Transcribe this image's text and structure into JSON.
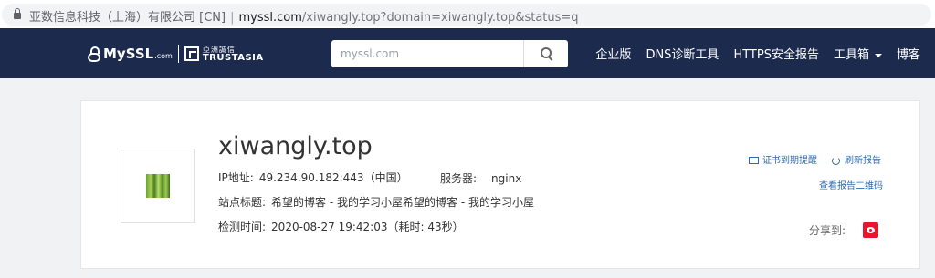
{
  "address_bar": {
    "org": "亚数信息科技（上海）有限公司 [CN]",
    "separator": "|",
    "domain": "myssl.com",
    "path": "/xiwangly.top?domain=xiwangly.top&status=q"
  },
  "nav": {
    "logo_text": "MySSL",
    "logo_suffix": ".com",
    "partner_cn": "亞洲誠信",
    "partner_en": "TRUSTASIA",
    "search_placeholder": "myssl.com",
    "links": [
      "企业版",
      "DNS诊断工具",
      "HTTPS安全报告",
      "工具箱",
      "博客"
    ]
  },
  "report": {
    "title": "xiwangly.top",
    "ip_label": "IP地址:",
    "ip_value": "49.234.90.182:443（中国）",
    "server_label": "服务器:",
    "server_value": "nginx",
    "site_title_label": "站点标题:",
    "site_title_value": "希望的博客 - 我的学习小屋希望的博客 - 我的学习小屋",
    "check_time_label": "检测时间:",
    "check_time_value": "2020-08-27 19:42:03（耗时: 43秒）",
    "actions": {
      "cert_reminder": "证书到期提醒",
      "refresh": "刷新报告",
      "qr": "查看报告二维码"
    },
    "share_label": "分享到:"
  },
  "colors": {
    "nav_bg": "#1c2a4e",
    "link_blue": "#2e6bb0",
    "weibo_red": "#e6162d"
  }
}
